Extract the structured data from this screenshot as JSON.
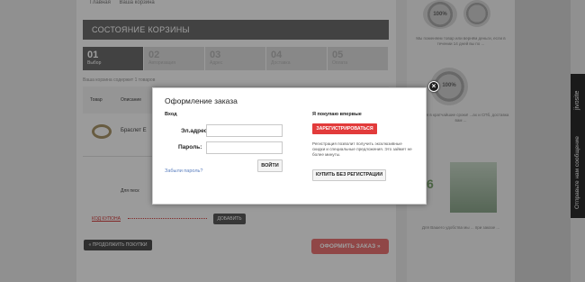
{
  "breadcrumb": [
    "Главная",
    "Ваша корзина"
  ],
  "cart": {
    "header": "СОСТОЯНИЕ КОРЗИНЫ",
    "steps": [
      {
        "num": "01",
        "label": "Выбор"
      },
      {
        "num": "02",
        "label": "Авторизация"
      },
      {
        "num": "03",
        "label": "Адрес"
      },
      {
        "num": "04",
        "label": "Доставка"
      },
      {
        "num": "05",
        "label": "Оплата"
      }
    ],
    "count_text": "Ваша корзина содержит 1 товаров",
    "columns": [
      "Товар",
      "Описание"
    ],
    "item_name": "Браслет Е",
    "total_text": "Для песк",
    "coupon_label": "КОД КУПОНА",
    "apply_label": "ДОБАВИТЬ",
    "continue_label": "« ПРОДОЛЖИТЬ ПОКУПКИ",
    "order_label": "ОФОРМИТЬ ЗАКАЗ »"
  },
  "sidebar": {
    "seal_top": "100%",
    "seal_bottom": "100%",
    "text_top": "Мы поменяем товар или вернём деньги, если в течении 14 дней вы по ...",
    "text_mid": "...ваться в кратчайшие сроки! ...ах и СПб, доставка вам ...",
    "text_bottom": "Для Вашего удобства мы ... при заказе ...",
    "tag": "6"
  },
  "feedback": {
    "label": "Отправьте нам сообщение",
    "top_label": "jivosite"
  },
  "modal": {
    "title": "Оформление заказа",
    "login": {
      "heading": "Вход",
      "email_label": "Эл.адрес:",
      "email_value": "",
      "password_label": "Пароль:",
      "password_value": "",
      "forgot_link": "Забыли пароль?",
      "submit": "ВОЙТИ"
    },
    "register": {
      "heading": "Я покупаю впервые",
      "register_button": "ЗАРЕГИСТРИРОВАТЬСЯ",
      "note": "Регистрация позволит получить эксклюзивные скидки и специальные предложения. Это займет не более минуты.",
      "guest_button": "КУПИТЬ БЕЗ РЕГИСТРАЦИИ"
    },
    "close_glyph": "×"
  }
}
